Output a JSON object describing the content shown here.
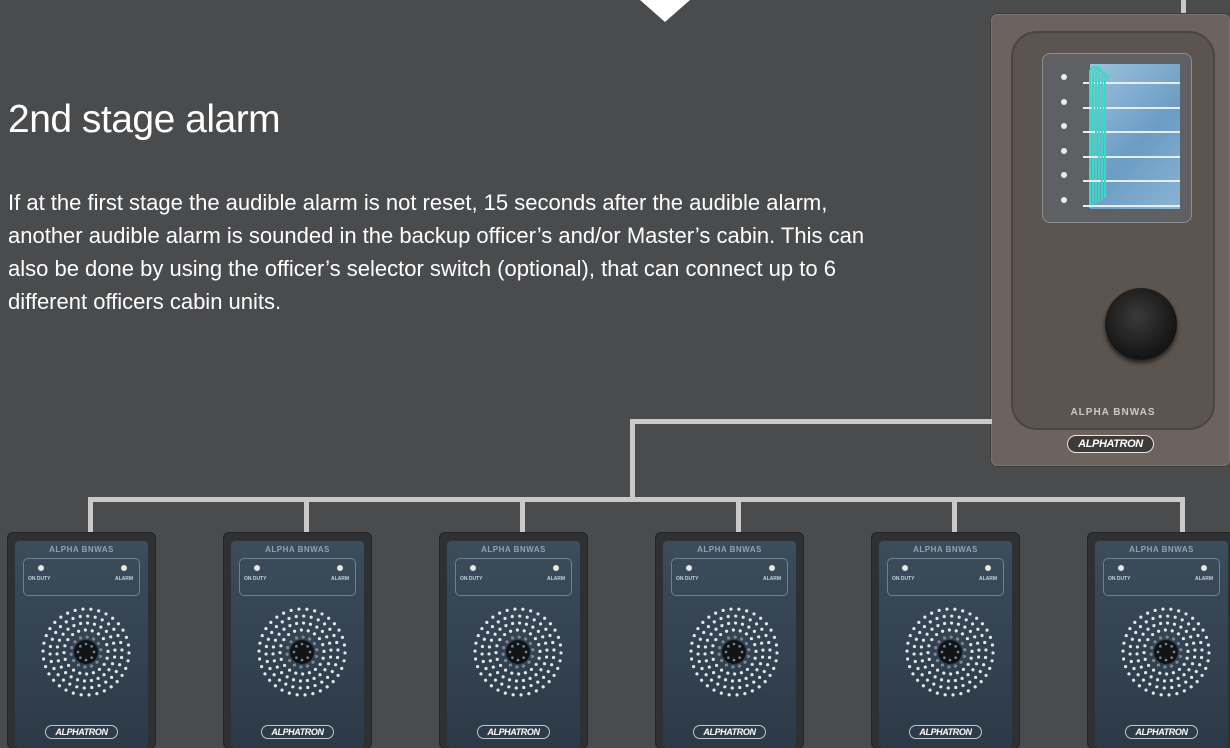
{
  "heading": "2nd stage alarm",
  "description": "If at the first stage the audible alarm is not reset, 15 seconds after the audible alarm, another audible alarm is sounded in the backup officer’s and/or Master’s cabin. This can also be done by using the officer’s selector switch (optional), that can connect up to 6 different officers cabin units.",
  "main_panel": {
    "brand_label": "ALPHA BNWAS",
    "logo_text": "ALPHATRON",
    "indicator_count": 6
  },
  "cabin_units": [
    {
      "title": "ALPHA BNWAS",
      "on_duty_label": "ON DUTY",
      "alarm_label": "ALARM",
      "logo_text": "ALPHATRON"
    },
    {
      "title": "ALPHA BNWAS",
      "on_duty_label": "ON DUTY",
      "alarm_label": "ALARM",
      "logo_text": "ALPHATRON"
    },
    {
      "title": "ALPHA BNWAS",
      "on_duty_label": "ON DUTY",
      "alarm_label": "ALARM",
      "logo_text": "ALPHATRON"
    },
    {
      "title": "ALPHA BNWAS",
      "on_duty_label": "ON DUTY",
      "alarm_label": "ALARM",
      "logo_text": "ALPHATRON"
    },
    {
      "title": "ALPHA BNWAS",
      "on_duty_label": "ON DUTY",
      "alarm_label": "ALARM",
      "logo_text": "ALPHATRON"
    },
    {
      "title": "ALPHA BNWAS",
      "on_duty_label": "ON DUTY",
      "alarm_label": "ALARM",
      "logo_text": "ALPHATRON"
    }
  ],
  "colors": {
    "background": "#4a4b4d",
    "text": "#ffffff",
    "connector": "#c9c9c9",
    "panel": "#6c635f",
    "unit_face": "#3b4c5b",
    "trace": "#3ed7c3"
  }
}
